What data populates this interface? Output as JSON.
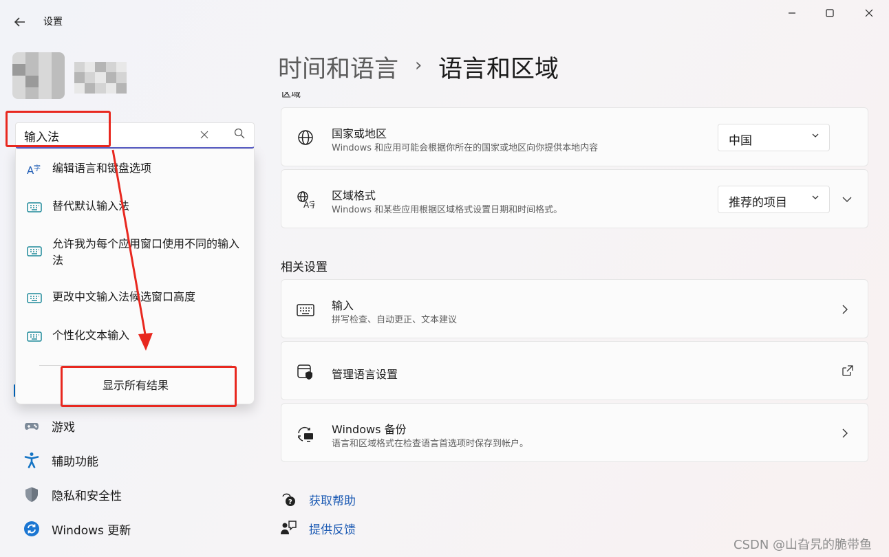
{
  "window": {
    "title": "设置",
    "back_icon": "back-arrow-icon",
    "controls": [
      "minimize-icon",
      "maximize-icon",
      "close-icon"
    ]
  },
  "search": {
    "value": "输入法",
    "results": [
      {
        "label": "编辑语言和键盘选项",
        "icon": "language-icon"
      },
      {
        "label": "替代默认输入法",
        "icon": "keyboard-icon"
      },
      {
        "label": "允许我为每个应用窗口使用不同的输入法",
        "icon": "keyboard-icon"
      },
      {
        "label": "更改中文输入法候选窗口高度",
        "icon": "keyboard-icon"
      },
      {
        "label": "个性化文本输入",
        "icon": "keyboard-icon"
      }
    ],
    "show_all": "显示所有结果"
  },
  "sidebar": {
    "items": [
      {
        "label": "游戏",
        "icon": "gamepad-icon"
      },
      {
        "label": "辅助功能",
        "icon": "accessibility-icon"
      },
      {
        "label": "隐私和安全性",
        "icon": "shield-icon"
      },
      {
        "label": "Windows 更新",
        "icon": "update-icon"
      }
    ]
  },
  "breadcrumb": {
    "parent": "时间和语言",
    "separator": "›",
    "current": "语言和区域"
  },
  "region": {
    "section_title": "区域",
    "country": {
      "title": "国家或地区",
      "subtitle": "Windows 和应用可能会根据你所在的国家或地区向你提供本地内容",
      "value": "中国"
    },
    "format": {
      "title": "区域格式",
      "subtitle": "Windows 和某些应用根据区域格式设置日期和时间格式。",
      "value": "推荐的项目"
    }
  },
  "related": {
    "section_title": "相关设置",
    "items": [
      {
        "title": "输入",
        "subtitle": "拼写检查、自动更正、文本建议"
      },
      {
        "title": "管理语言设置",
        "subtitle": ""
      },
      {
        "title": "Windows 备份",
        "subtitle": "语言和区域格式在检查语言首选项时保存到帐户。"
      }
    ]
  },
  "help": {
    "get_help": "获取帮助",
    "feedback": "提供反馈"
  },
  "watermark": "CSDN @山旮旯的脆带鱼",
  "colors": {
    "accent": "#0067c0",
    "link": "#1d5bb4",
    "annotation": "#e8281f"
  }
}
